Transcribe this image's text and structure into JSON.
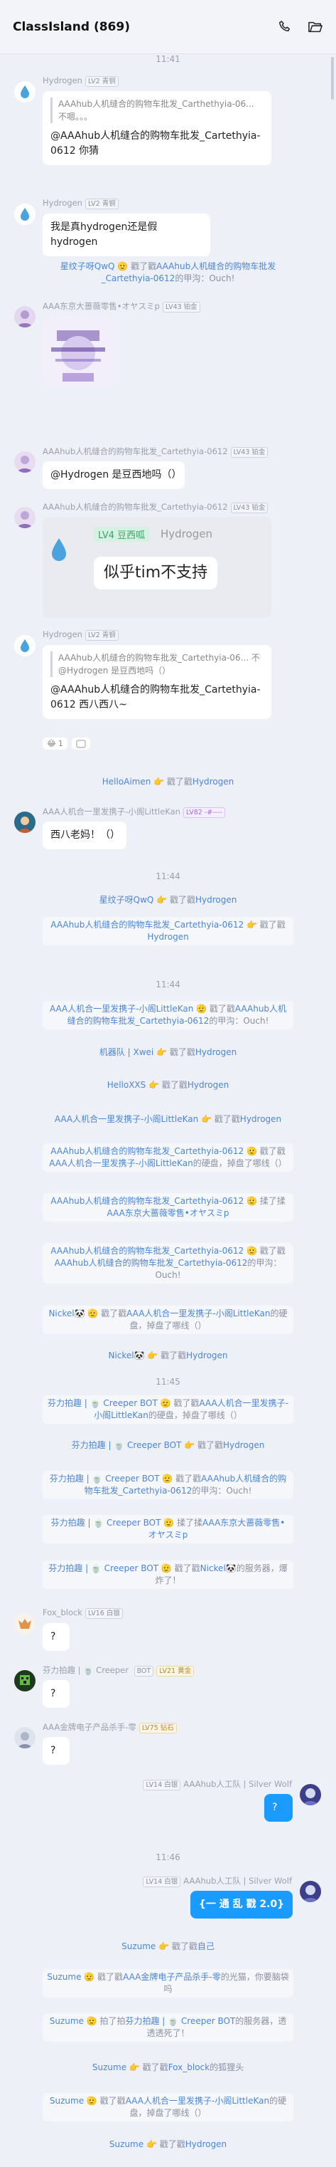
{
  "window": {
    "title": "ClassIsland (869)"
  },
  "icons": {
    "phone": "phone-icon",
    "folder": "folder-open-icon"
  },
  "colors": {
    "link": "#4a86d6",
    "self_bubble": "#1a9bff"
  },
  "times": {
    "t1": "11:41",
    "t2": "11:44",
    "t3": "11:44",
    "t4": "11:45",
    "t5": "11:46"
  },
  "messages": {
    "m1": {
      "name": "Hydrogen",
      "tag": "LV2 青铜",
      "quote": "AAAhub人机缝合的购物车批发_Carthethyia-06... 不嗯。。。",
      "text": "@AAAhub人机缝合的购物车批发_Cartethyia-0612 你猜"
    },
    "m2": {
      "name": "Hydrogen",
      "tag": "LV2 青铜",
      "text": "我是真hydrogen还是假hydrogen"
    },
    "m3": {
      "name": "AAA东京大蔷薇零售•オヤスミp",
      "tag": "LV43 铂金"
    },
    "m4": {
      "name": "AAAhub人机缝合的购物车批发_Cartethyia-0612",
      "tag": "LV43 铂金",
      "text": "@Hydrogen 是豆西地吗（）"
    },
    "m5": {
      "name": "AAAhub人机缝合的购物车批发_Cartethyia-0612",
      "tag": "LV43 铂金",
      "card_lv": "LV4 豆西呱",
      "card_name": "Hydrogen",
      "card_text": "似乎tim不支持"
    },
    "m6": {
      "name": "Hydrogen",
      "tag": "LV2 青铜",
      "quote": "AAAhub人机缝合的购物车批发_Cartethyia-06... 不@Hydrogen 是豆西地吗（）",
      "text": "@AAAhub人机缝合的购物车批发_Cartethyia-0612 西八西八~",
      "react1": "1"
    },
    "m7": {
      "name": "AAA人机合一里发携子-小阁LittleKan",
      "tag": "LV82 -#----",
      "text": "西八老妈！（）"
    },
    "m8": {
      "name": "Fox_block",
      "tag": "LV16 白银",
      "text": "?"
    },
    "m9": {
      "name": "芬力拍趣 | 🍵 Creeper",
      "bot": "BOT",
      "tag": "LV21 黄金",
      "text": "?"
    },
    "m10": {
      "name": "AAA金牌电子产品杀手-零",
      "tag": "LV75 钻石",
      "text": "?"
    },
    "m11": {
      "name": "AAAhub人工队 | Silver Wolf",
      "tag": "LV14 白银",
      "text": "?"
    },
    "m12": {
      "name": "AAAhub人工队 | Silver Wolf",
      "tag": "LV14 白银",
      "text": "{一 通 乱 戳 2.0}"
    }
  },
  "sys": {
    "s1": {
      "u1": "星纹子呀QwQ",
      "mid": " 🫡 戳了戳",
      "u2": "AAAhub人机缝合的购物车批发_Cartethyia-0612",
      "tail": "的甲沟：Ouch!"
    },
    "s2": {
      "u1": "HelloAimen",
      "mid": " 👉 戳了戳",
      "u2": "Hydrogen"
    },
    "s3": {
      "u1": "星纹子呀QwQ",
      "mid": " 👉 戳了戳",
      "u2": "Hydrogen"
    },
    "s4": {
      "u1": "AAAhub人机缝合的购物车批发_Cartethyia-0612",
      "mid": " 👉 戳了戳",
      "u2": "Hydrogen"
    },
    "s5": {
      "u1": "AAA人机合一里发携子-小阁LittleKan",
      "mid": " 🫡 戳了戳",
      "u2": "AAAhub人机缝合的购物车批发_Cartethyia-0612",
      "tail": "的甲沟：Ouch!"
    },
    "s6": {
      "u1": "机器队 | Xwei",
      "mid": " 👉 戳了戳",
      "u2": "Hydrogen"
    },
    "s7": {
      "u1": "HelloXXS",
      "mid": " 👉 戳了戳",
      "u2": "Hydrogen"
    },
    "s8": {
      "u1": "AAA人机合一里发携子-小阁LittleKan",
      "mid": " 👉 戳了戳",
      "u2": "Hydrogen"
    },
    "s9": {
      "u1": "AAAhub人机缝合的购物车批发_Cartethyia-0612",
      "mid": " 🫡 戳了戳",
      "u2": "AAA人机合一里发携子-小阁LittleKan",
      "tail": "的硬盘，掉盘了哪线（）"
    },
    "s10": {
      "u1": "AAAhub人机缝合的购物车批发_Cartethyia-0612",
      "mid": " 🫡 揉了揉",
      "u2": "AAA东京大蔷薇零售•オヤスミp"
    },
    "s11": {
      "u1": "AAAhub人机缝合的购物车批发_Cartethyia-0612",
      "mid": " 🫡 戳了戳",
      "u2": "AAAhub人机缝合的购物车批发_Cartethyia-0612",
      "tail": "的甲沟：Ouch!"
    },
    "s12": {
      "u1": "Nickel🐼",
      "mid": " 🫡 戳了戳",
      "u2": "AAA人机合一里发携子-小阁LittleKan",
      "tail": "的硬盘，掉盘了哪线（）"
    },
    "s13": {
      "u1": "Nickel🐼",
      "mid": " 👉 戳了戳",
      "u2": "Hydrogen"
    },
    "s14": {
      "u1": "芬力拍趣 | 🍵 Creeper BOT",
      "mid": " 🫡 戳了戳",
      "u2": "AAA人机合一里发携子-小阁LittleKan",
      "tail": "的硬盘，掉盘了哪线（）"
    },
    "s15": {
      "u1": "芬力拍趣 | 🍵 Creeper BOT",
      "mid": " 👉 戳了戳",
      "u2": "Hydrogen"
    },
    "s16": {
      "u1": "芬力拍趣 | 🍵 Creeper BOT",
      "mid": " 🫡 戳了戳",
      "u2": "AAAhub人机缝合的购物车批发_Cartethyia-0612",
      "tail": "的甲沟：Ouch!"
    },
    "s17": {
      "u1": "芬力拍趣 | 🍵 Creeper BOT",
      "mid": " 🫡 揉了揉",
      "u2": "AAA东京大蔷薇零售•オヤスミp"
    },
    "s18": {
      "u1": "芬力拍趣 | 🍵 Creeper BOT",
      "mid": " 🫡 戳了戳",
      "u2": "Nickel🐼",
      "tail": "的服务器，爆炸了！"
    },
    "s19": {
      "u1": "Suzume",
      "mid": " 👉 戳了戳",
      "u2": "自己"
    },
    "s20": {
      "u1": "Suzume",
      "mid": " 🫡 戳了戳",
      "u2": "AAA金牌电子产品杀手-零",
      "tail": "的光猫，你要脑袋吗"
    },
    "s21": {
      "u1": "Suzume",
      "mid": " 🫡 拍了拍",
      "u2": "芬力拍趣 | 🍵 Creeper BOT",
      "tail": "的服务器，透透透死了！"
    },
    "s22": {
      "u1": "Suzume",
      "mid": " 👉 戳了戳",
      "u2": "Fox_block",
      "tail": "的狐狸头"
    },
    "s23": {
      "u1": "Suzume",
      "mid": " 🫡 戳了戳",
      "u2": "AAA人机合一里发携子-小阁LittleKan",
      "tail": "的硬盘，掉盘了哪线（）"
    },
    "s24": {
      "u1": "Suzume",
      "mid": " 👉 戳了戳",
      "u2": "Hydrogen"
    }
  }
}
